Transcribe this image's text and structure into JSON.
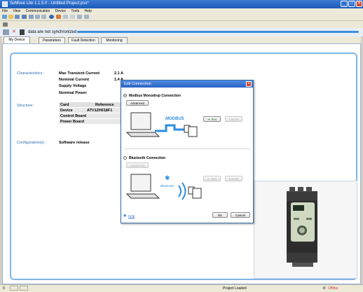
{
  "window": {
    "title": "SoMove Lite 1.1.5.0 - Untitled Project.psx*",
    "minimize": "_",
    "maximize": "□",
    "close": "✕"
  },
  "menu": [
    "File",
    "View",
    "Communication",
    "Device",
    "Tools",
    "Help"
  ],
  "connection_status": "data are not synchronized",
  "tabs": [
    {
      "label": "My Device",
      "active": true
    },
    {
      "label": "Parameters",
      "active": false
    },
    {
      "label": "Fault Detection",
      "active": false
    },
    {
      "label": "Monitoring",
      "active": false
    }
  ],
  "main": {
    "characteristics_label": "Characteristics :",
    "characteristics": [
      {
        "name": "Max Transient Current",
        "value": "2.1 A"
      },
      {
        "name": "Nominal Current",
        "value": "1.4 A"
      },
      {
        "name": "Supply Voltage",
        "value": ""
      },
      {
        "name": "Nominal Power",
        "value": ""
      }
    ],
    "structure_label": "Structure:",
    "structure_table": {
      "headers": [
        "Card",
        "Reference",
        "V"
      ],
      "rows": [
        [
          "Device",
          "ATV12H018F1"
        ],
        [
          "Control Board",
          ""
        ],
        [
          "Power Board",
          ""
        ]
      ]
    },
    "configuration_label": "Configuration(s) :",
    "software_release": "Software release"
  },
  "dialog": {
    "title": "Edit Connection",
    "modbus_label": "Modbus Monodrop Connection",
    "advanced1": "Advanced",
    "modbus_logo": "MODBUS",
    "test1": "Test",
    "cancel1": "Cancel",
    "bluetooth_label": "Bluetooth Connection",
    "advanced2": "Advanced",
    "bluetooth_logo": "Bluetooth",
    "test2": "Test",
    "cancel2": "Cancel",
    "help": "Help",
    "ok": "OK",
    "cancel": "Cancel"
  },
  "statusbar": {
    "left": "0",
    "center": "Project Loaded",
    "right": "Offline"
  },
  "colors": {
    "accent": "#3d8fd8",
    "section_label": "#2e6bb0",
    "titlebar": "#1b5bb7"
  }
}
